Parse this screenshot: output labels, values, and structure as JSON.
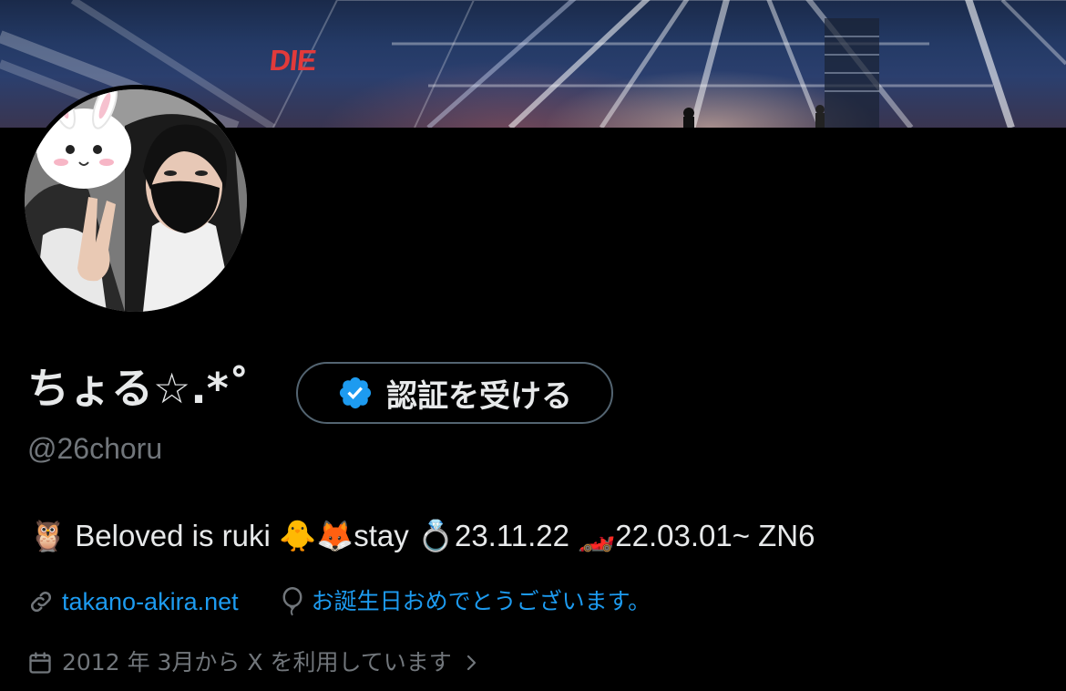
{
  "banner": {
    "sign_text": "DIE"
  },
  "profile": {
    "display_name": "ちょる☆.*˚",
    "handle": "@26choru",
    "verify_button_label": "認証を受ける",
    "bio": "🦉 Beloved is ruki 🐥🦊stay 💍23.11.22 🏎️22.03.01~ ZN6",
    "website": "takano-akira.net",
    "birthday_text": "お誕生日おめでとうございます。",
    "joined_text": "2012 年 3月から X を利用しています"
  },
  "colors": {
    "background": "#000000",
    "text_primary": "#e7e9ea",
    "text_secondary": "#71767b",
    "link": "#1d9bf0",
    "verified_badge": "#1d9bf0",
    "button_border": "#536471"
  },
  "icons": {
    "verified": "verified-badge-icon",
    "link": "link-icon",
    "birthday": "balloon-icon",
    "calendar": "calendar-icon",
    "chevron": "chevron-right-icon"
  }
}
